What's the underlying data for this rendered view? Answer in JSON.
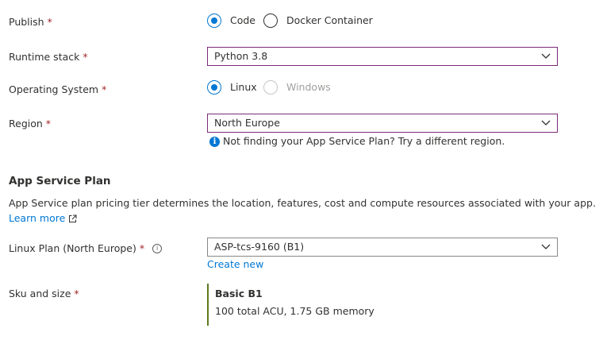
{
  "publish": {
    "label": "Publish",
    "required_mark": "*",
    "options": [
      {
        "label": "Code",
        "checked": true
      },
      {
        "label": "Docker Container",
        "checked": false
      }
    ]
  },
  "runtime": {
    "label": "Runtime stack",
    "required_mark": "*",
    "value": "Python 3.8"
  },
  "os": {
    "label": "Operating System",
    "required_mark": "*",
    "options": [
      {
        "label": "Linux",
        "checked": true,
        "disabled": false
      },
      {
        "label": "Windows",
        "checked": false,
        "disabled": true
      }
    ]
  },
  "region": {
    "label": "Region",
    "required_mark": "*",
    "value": "North Europe",
    "info_text": "Not finding your App Service Plan? Try a different region."
  },
  "plan_section": {
    "title": "App Service Plan",
    "description": "App Service plan pricing tier determines the location, features, cost and compute resources associated with your app.",
    "learn_more": "Learn more"
  },
  "linux_plan": {
    "label": "Linux Plan (North Europe)",
    "required_mark": "*",
    "help_glyph": "i",
    "value": "ASP-tcs-9160 (B1)",
    "create_new": "Create new"
  },
  "sku": {
    "label": "Sku and size",
    "required_mark": "*",
    "name": "Basic B1",
    "detail": "100 total ACU, 1.75 GB memory"
  },
  "colors": {
    "accent_blue": "#0078d4",
    "required_red": "#a4262c",
    "focus_border": "#7a2a78",
    "sku_bar": "#5c7a1f"
  },
  "icons": {
    "info": "info-icon",
    "external_link": "external-link-icon",
    "dropdown": "chevron-down-icon",
    "help": "help-info-icon"
  }
}
